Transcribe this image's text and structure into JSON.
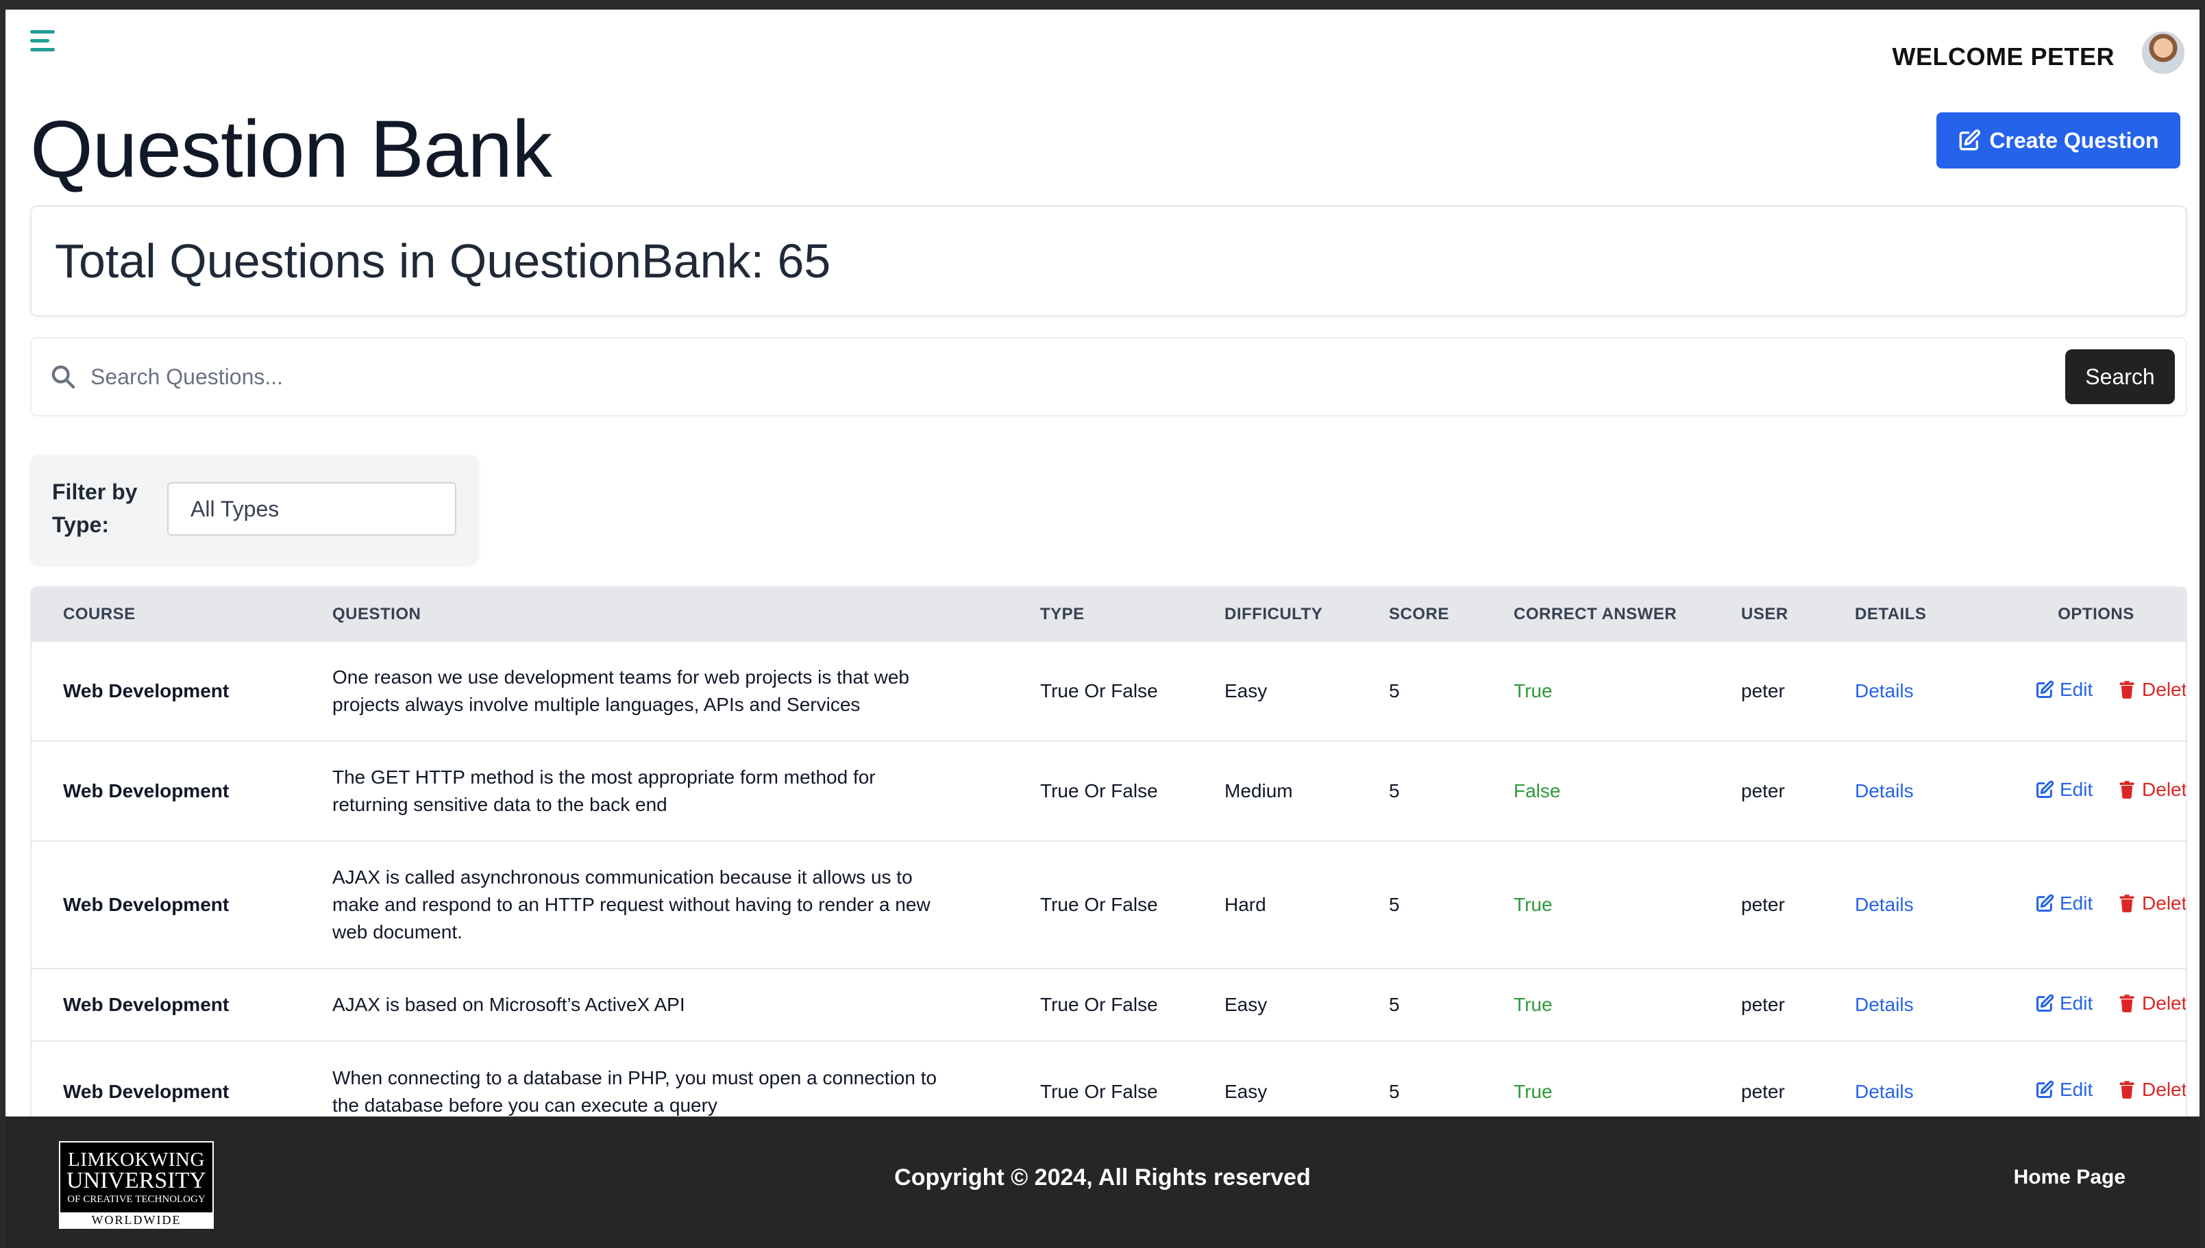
{
  "header": {
    "welcome_text": "WELCOME PETER",
    "menu_icon": "hamburger-menu-icon",
    "avatar_icon": "user-avatar"
  },
  "page": {
    "title": "Question Bank",
    "create_button_label": "Create Question",
    "create_button_icon": "edit-icon",
    "total_text": "Total Questions in QuestionBank: 65"
  },
  "search": {
    "placeholder": "Search Questions...",
    "button_label": "Search",
    "icon": "search-icon"
  },
  "filter": {
    "label": "Filter by Type:",
    "selected": "All Types"
  },
  "table": {
    "headers": {
      "course": "COURSE",
      "question": "QUESTION",
      "type": "TYPE",
      "difficulty": "DIFFICULTY",
      "score": "SCORE",
      "correct_answer": "CORRECT ANSWER",
      "user": "USER",
      "details": "DETAILS",
      "options": "OPTIONS"
    },
    "rows": [
      {
        "course": "Web Development",
        "question": "One reason we use development teams for web projects is that web projects always involve multiple languages, APIs and Services",
        "type": "True Or False",
        "difficulty": "Easy",
        "score": "5",
        "correct_answer": "True",
        "user": "peter",
        "details": "Details",
        "edit": "Edit",
        "delete": "Delete"
      },
      {
        "course": "Web Development",
        "question": "The GET HTTP method is the most appropriate form method for returning sensitive data to the back end",
        "type": "True Or False",
        "difficulty": "Medium",
        "score": "5",
        "correct_answer": "False",
        "user": "peter",
        "details": "Details",
        "edit": "Edit",
        "delete": "Delete"
      },
      {
        "course": "Web Development",
        "question": "AJAX is called asynchronous communication because it allows us to make and respond to an HTTP request without having to render a new web document.",
        "type": "True Or False",
        "difficulty": "Hard",
        "score": "5",
        "correct_answer": "True",
        "user": "peter",
        "details": "Details",
        "edit": "Edit",
        "delete": "Delete"
      },
      {
        "course": "Web Development",
        "question": "AJAX is based on Microsoft’s ActiveX API",
        "type": "True Or False",
        "difficulty": "Easy",
        "score": "5",
        "correct_answer": "True",
        "user": "peter",
        "details": "Details",
        "edit": "Edit",
        "delete": "Delete"
      },
      {
        "course": "Web Development",
        "question": "When connecting to a database in PHP, you must open a connection to the database before you can execute a query",
        "type": "True Or False",
        "difficulty": "Easy",
        "score": "5",
        "correct_answer": "True",
        "user": "peter",
        "details": "Details",
        "edit": "Edit",
        "delete": "Delete"
      }
    ]
  },
  "footer": {
    "logo_line1": "LIMKOKWING",
    "logo_line2": "UNIVERSITY",
    "logo_line3": "OF CREATIVE TECHNOLOGY",
    "logo_line4": "WORLDWIDE",
    "copyright": "Copyright © 2024, All Rights reserved",
    "home_link": "Home Page"
  },
  "colors": {
    "primary": "#2563eb",
    "accent_menu": "#1e9e93",
    "answer_green": "#2e9a3a",
    "delete_red": "#dc2626",
    "footer_bg": "#262626"
  }
}
